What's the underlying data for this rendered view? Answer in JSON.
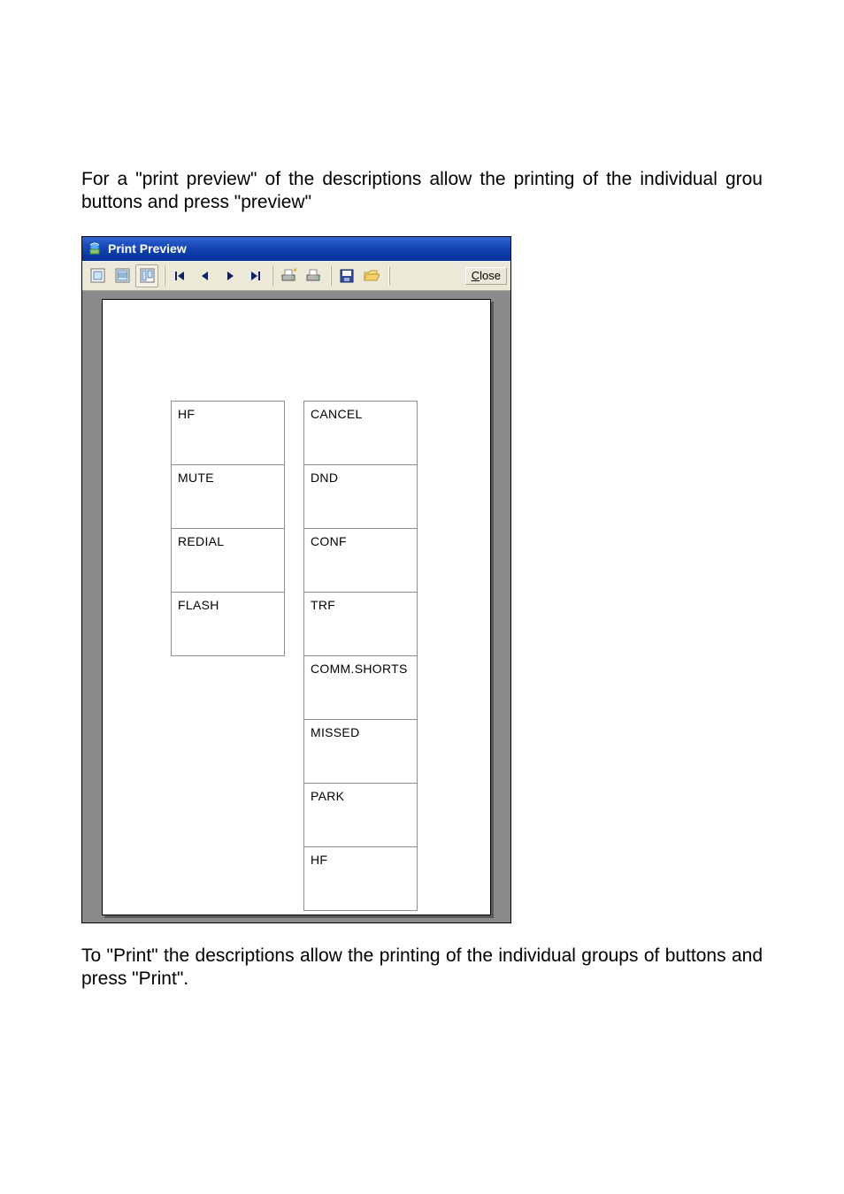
{
  "intro_text": "For a \"print preview\" of the descriptions allow the printing of the individual grou buttons and press \"preview\"",
  "outro_text": "To \"Print\" the descriptions allow the printing of the individual groups of buttons and press \"Print\".",
  "window": {
    "title": "Print Preview",
    "close_label_first": "C",
    "close_label_rest": "lose"
  },
  "preview": {
    "left_column": [
      "HF",
      "MUTE",
      "REDIAL",
      "FLASH"
    ],
    "right_column": [
      "CANCEL",
      "DND",
      "CONF",
      "TRF",
      "COMM.SHORTS",
      "MISSED",
      "PARK",
      "HF"
    ]
  }
}
